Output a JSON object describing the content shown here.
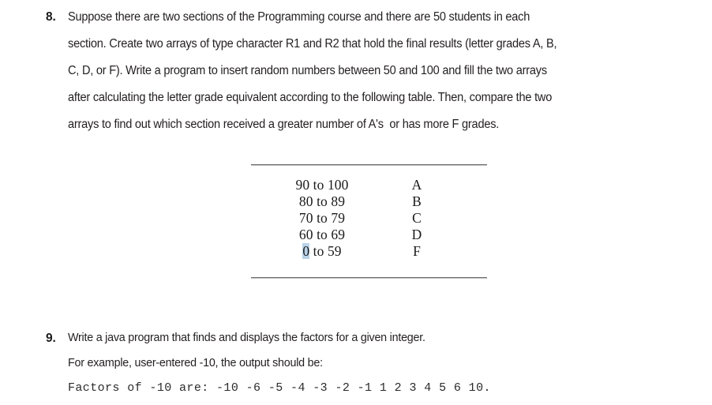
{
  "document": {
    "background_color": "#ffffff",
    "text_color": "#231f20"
  },
  "questions": [
    {
      "number": "8.",
      "lines": [
        "Suppose there are two sections of the Programming course and there are 50 students in each",
        "section. Create two arrays of type character R1 and R2 that hold the final results (letter grades A, B,",
        "C, D, or F). Write a program to insert random numbers between 50 and 100 and fill the two arrays",
        "after calculating the letter grade equivalent according to the following table. Then, compare the two",
        "arrays to find out which section received a greater number of A's  or has more F grades."
      ]
    },
    {
      "number": "9.",
      "lines": [
        "Write a java program that finds and displays the factors for a given integer.",
        "For example, user-entered -10, the output should be:"
      ],
      "output_line": "Factors of -10 are: -10 -6 -5 -4 -3 -2 -1 1 2 3 4 5 6 10."
    }
  ],
  "grade_table": {
    "selection_highlight_color": "#b9d3e8",
    "rule_color": "#6e6e6e",
    "rows": [
      {
        "range": "90 to 100",
        "grade": "A",
        "highlight_prefix": ""
      },
      {
        "range": "80 to 89",
        "grade": "B",
        "highlight_prefix": ""
      },
      {
        "range": "70 to 79",
        "grade": "C",
        "highlight_prefix": ""
      },
      {
        "range": "60 to 69",
        "grade": "D",
        "highlight_prefix": ""
      },
      {
        "range": " to 59",
        "grade": "F",
        "highlight_prefix": "0"
      }
    ]
  }
}
